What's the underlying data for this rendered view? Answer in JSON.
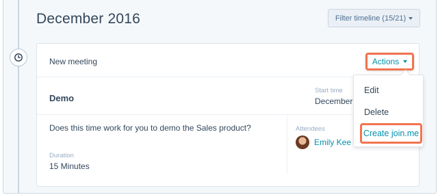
{
  "timeline": {
    "month_title": "December 2016",
    "filter_label": "Filter timeline (15/21)"
  },
  "card": {
    "header_title": "New meeting",
    "actions_label": "Actions",
    "meeting_name": "Demo",
    "start_time_label": "Start time",
    "start_time_value": "December",
    "description": "Does this time work for you to demo the Sales product?",
    "duration_label": "Duration",
    "duration_value": "15 Minutes",
    "attendees_label": "Attendees",
    "attendee_name": "Emily Kee"
  },
  "actions_menu": {
    "items": [
      "Edit",
      "Delete",
      "Create join.me"
    ]
  },
  "colors": {
    "highlight": "#f2734e",
    "link": "#0091ae",
    "text": "#33475b",
    "muted": "#99acc2"
  },
  "icons": {
    "timeline_icon": "clock-icon",
    "filter_caret": "caret-down-icon",
    "actions_caret": "caret-down-icon"
  }
}
